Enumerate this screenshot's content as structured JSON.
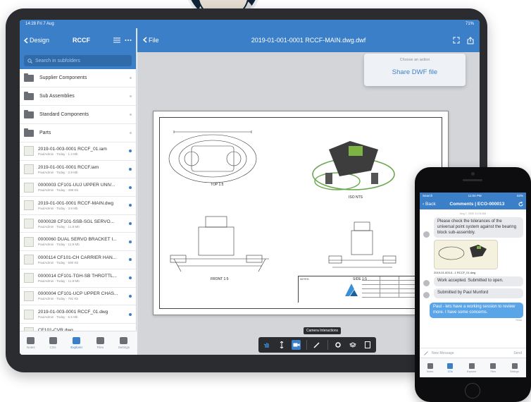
{
  "tablet": {
    "status": {
      "time": "14:28  Fri 7 Aug",
      "battery": "71%"
    },
    "left": {
      "back_label": "Design",
      "title": "RCCF",
      "search_placeholder": "Search in subfolders",
      "folders": [
        {
          "label": "Supplier Components"
        },
        {
          "label": "Sub Assemblies"
        },
        {
          "label": "Standard Components"
        },
        {
          "label": "Parts"
        }
      ],
      "files": [
        {
          "name": "2019-01-003-0001 RCCF_01.iam",
          "meta": "PaulAdmin · Today · 1.2 Mb"
        },
        {
          "name": "2019-01-001-0001 RCCF.iam",
          "meta": "PaulAdmin · Today · 2.9 Mb"
        },
        {
          "name": "0000003 CF101-UUJ UPPER UNIV...",
          "meta": "PaulAdmin · Today · 498 Kb"
        },
        {
          "name": "2019-01-001-0001 RCCF-MAIN.dwg",
          "meta": "PaulAdmin · Today · 3.9 Mb"
        },
        {
          "name": "0000028 CF101-SSB-SGL SERVO...",
          "meta": "PaulAdmin · Today · 11.8 Mb"
        },
        {
          "name": "0000060 DUAL SERVO BRACKET I...",
          "meta": "PaulAdmin · Today · 11.9 Mb"
        },
        {
          "name": "0000114 CF101-CH CARRIER HAN...",
          "meta": "PaulAdmin · Today · 590 Kb"
        },
        {
          "name": "0000014 CF101-TGH-SB THROTTL...",
          "meta": "PaulAdmin · Today · 11.8 Mb"
        },
        {
          "name": "0000004 CF101-UCP UPPER CHAS...",
          "meta": "PaulAdmin · Today · 791 Kb"
        },
        {
          "name": "2019-01-003-0001 RCCF_01.dwg",
          "meta": "PaulAdmin · Today · 5.5 Mb"
        },
        {
          "name": "CF101-CVR.dwg",
          "meta": "PaulAdmin · Today · 1.4 Mb"
        }
      ],
      "tabs": [
        {
          "label": "Notes"
        },
        {
          "label": "COs"
        },
        {
          "label": "Explorer"
        },
        {
          "label": "Files"
        },
        {
          "label": "Settings"
        }
      ]
    },
    "right": {
      "back_label": "File",
      "title": "2019-01-001-0001 RCCF-MAIN.dwg.dwf",
      "action_menu": {
        "header": "Choose an action",
        "button": "Share DWF file"
      },
      "views": {
        "top": "TOP 1:5",
        "iso": "ISO  NTS",
        "front": "FRONT 1:5",
        "side": "SIDE 1:5"
      },
      "title_block_notes": "NOTES:",
      "toolbar_tooltip": "Camera Interactions"
    }
  },
  "phone": {
    "status": {
      "carrier": "Search",
      "time": "11:04 PM",
      "battery": "53%"
    },
    "back_label": "Back",
    "title": "Comments | ECO-000013",
    "date": "Aug 7, 2020 11:04 AM",
    "messages": [
      {
        "text": "Please check the tolerances of the universal  point system against the bearing block sub-assembly."
      },
      {
        "caption": "2019-01-003-0...1 RCCF_01.dwg"
      },
      {
        "text": "Work accepted. Submitted to open."
      },
      {
        "text": "Submitted by Paul Munford"
      },
      {
        "text": "Paul - lets have a working session to review more. I have some concerns."
      }
    ],
    "read_label": "Read",
    "input_placeholder": "New Message",
    "send_label": "Send",
    "tabs": [
      {
        "label": "Notes"
      },
      {
        "label": "COs"
      },
      {
        "label": "Explorer"
      },
      {
        "label": "Files"
      },
      {
        "label": "Settings"
      }
    ]
  }
}
